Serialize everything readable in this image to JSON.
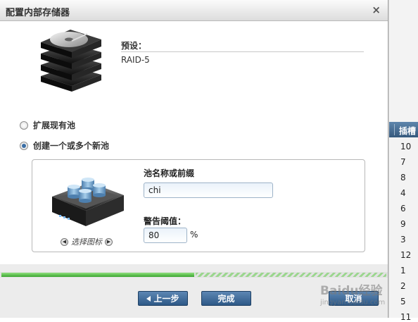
{
  "dialog": {
    "title": "配置内部存储器",
    "close_glyph": "×"
  },
  "preset": {
    "label": "预设：",
    "value": "RAID-5"
  },
  "options": {
    "extend_existing": "扩展现有池",
    "create_new": "创建一个或多个新池",
    "selected": "create_new"
  },
  "pool": {
    "name_label": "池名称或前缀",
    "name_value": "chi",
    "threshold_label": "警告阈值：",
    "threshold_value": "80",
    "percent_sign": "%",
    "select_icon_label": "选择图标",
    "prev_icon_glyph": "◀",
    "next_icon_glyph": "▶"
  },
  "progress": {
    "value": 0.5
  },
  "footer": {
    "back_label": "上一步",
    "finish_label": "完成",
    "cancel_label": "取消"
  },
  "background_table": {
    "header": "插槽",
    "values": [
      "10",
      "7",
      "8",
      "4",
      "6",
      "9",
      "3",
      "12",
      "1",
      "2",
      "5",
      "11"
    ]
  },
  "watermark": {
    "text": "Baidu经验",
    "url": "jingyan.baidu.com"
  },
  "colors": {
    "accent": "#2e5987",
    "progress": "#3aa52f"
  }
}
